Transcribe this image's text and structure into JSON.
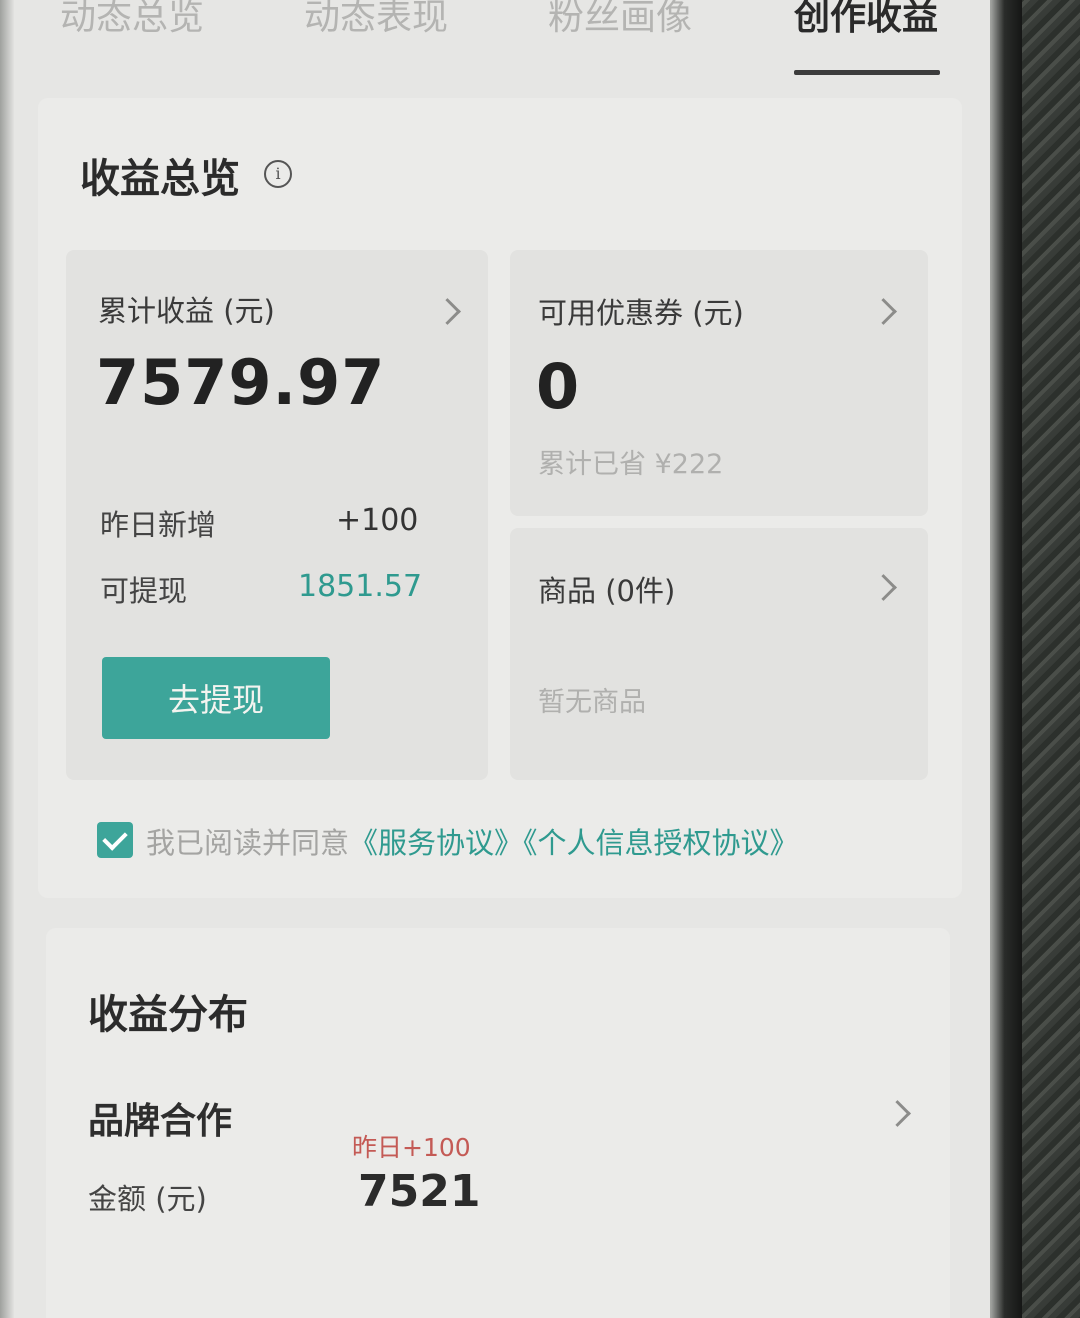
{
  "tabs": [
    {
      "label": "动态总览",
      "active": false
    },
    {
      "label": "动态表现",
      "active": false
    },
    {
      "label": "粉丝画像",
      "active": false
    },
    {
      "label": "创作收益",
      "active": true
    }
  ],
  "overview": {
    "title": "收益总览",
    "info_icon": "info-icon",
    "total": {
      "label": "累计收益 (元)",
      "value": "7579.97",
      "yesterday_label": "昨日新增",
      "yesterday_value": "+100",
      "withdrawable_label": "可提现",
      "withdrawable_value": "1851.57",
      "button_label": "去提现"
    },
    "coupon": {
      "label": "可用优惠券 (元)",
      "value": "0",
      "saved_text": "累计已省 ¥222"
    },
    "goods": {
      "label": "商品 (0件)",
      "empty_text": "暂无商品"
    },
    "agreement": {
      "checked": true,
      "prefix": "我已阅读并同意",
      "service_link": "《服务协议》",
      "privacy_link": "《个人信息授权协议》"
    }
  },
  "distribution": {
    "title": "收益分布",
    "brand": {
      "title": "品牌合作",
      "amount_label": "金额 (元)",
      "yesterday_text": "昨日+100",
      "amount_value": "7521"
    }
  },
  "colors": {
    "accent": "#3da59a",
    "link": "#2f9a8f",
    "highlight_red": "#c45a55"
  }
}
